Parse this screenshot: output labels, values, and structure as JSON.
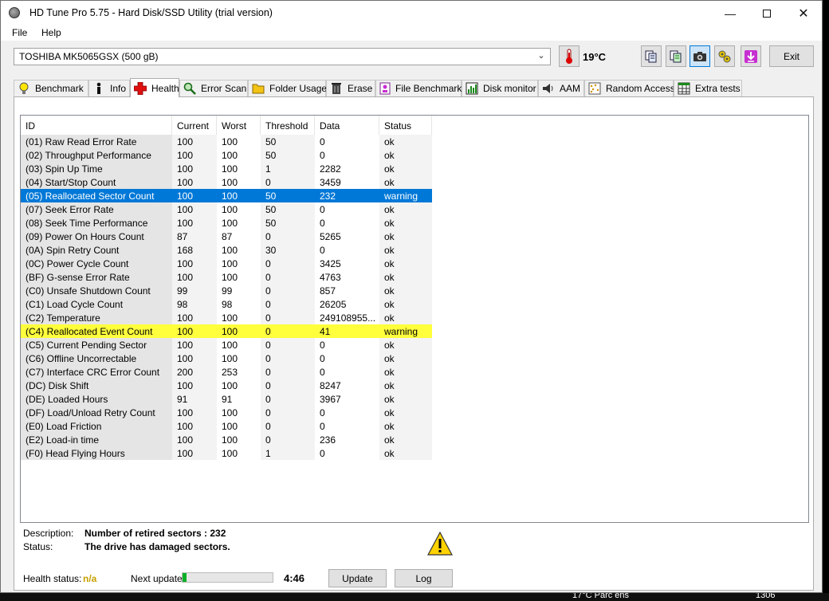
{
  "window": {
    "title": "HD Tune Pro 5.75 - Hard Disk/SSD Utility (trial version)"
  },
  "menu": {
    "file": "File",
    "help": "Help"
  },
  "toolbar": {
    "drive": "TOSHIBA MK5065GSX (500 gB)",
    "temperature": "19°C",
    "exit_label": "Exit"
  },
  "tabs": [
    {
      "label": "Benchmark",
      "icon": "bulb-icon"
    },
    {
      "label": "Info",
      "icon": "info-icon"
    },
    {
      "label": "Health",
      "icon": "cross-icon"
    },
    {
      "label": "Error Scan",
      "icon": "magnifier-icon"
    },
    {
      "label": "Folder Usage",
      "icon": "folder-icon"
    },
    {
      "label": "Erase",
      "icon": "trash-icon"
    },
    {
      "label": "File Benchmark",
      "icon": "file-icon"
    },
    {
      "label": "Disk monitor",
      "icon": "monitor-icon"
    },
    {
      "label": "AAM",
      "icon": "speaker-icon"
    },
    {
      "label": "Random Access",
      "icon": "dots-icon"
    },
    {
      "label": "Extra tests",
      "icon": "grid-icon"
    }
  ],
  "table": {
    "headers": {
      "id": "ID",
      "current": "Current",
      "worst": "Worst",
      "threshold": "Threshold",
      "data": "Data",
      "status": "Status"
    },
    "rows": [
      {
        "id": "(01) Raw Read Error Rate",
        "current": "100",
        "worst": "100",
        "threshold": "50",
        "data": "0",
        "status": "ok"
      },
      {
        "id": "(02) Throughput Performance",
        "current": "100",
        "worst": "100",
        "threshold": "50",
        "data": "0",
        "status": "ok"
      },
      {
        "id": "(03) Spin Up Time",
        "current": "100",
        "worst": "100",
        "threshold": "1",
        "data": "2282",
        "status": "ok"
      },
      {
        "id": "(04) Start/Stop Count",
        "current": "100",
        "worst": "100",
        "threshold": "0",
        "data": "3459",
        "status": "ok"
      },
      {
        "id": "(05) Reallocated Sector Count",
        "current": "100",
        "worst": "100",
        "threshold": "50",
        "data": "232",
        "status": "warning"
      },
      {
        "id": "(07) Seek Error Rate",
        "current": "100",
        "worst": "100",
        "threshold": "50",
        "data": "0",
        "status": "ok"
      },
      {
        "id": "(08) Seek Time Performance",
        "current": "100",
        "worst": "100",
        "threshold": "50",
        "data": "0",
        "status": "ok"
      },
      {
        "id": "(09) Power On Hours Count",
        "current": "87",
        "worst": "87",
        "threshold": "0",
        "data": "5265",
        "status": "ok"
      },
      {
        "id": "(0A) Spin Retry Count",
        "current": "168",
        "worst": "100",
        "threshold": "30",
        "data": "0",
        "status": "ok"
      },
      {
        "id": "(0C) Power Cycle Count",
        "current": "100",
        "worst": "100",
        "threshold": "0",
        "data": "3425",
        "status": "ok"
      },
      {
        "id": "(BF) G-sense Error Rate",
        "current": "100",
        "worst": "100",
        "threshold": "0",
        "data": "4763",
        "status": "ok"
      },
      {
        "id": "(C0) Unsafe Shutdown Count",
        "current": "99",
        "worst": "99",
        "threshold": "0",
        "data": "857",
        "status": "ok"
      },
      {
        "id": "(C1) Load Cycle Count",
        "current": "98",
        "worst": "98",
        "threshold": "0",
        "data": "26205",
        "status": "ok"
      },
      {
        "id": "(C2) Temperature",
        "current": "100",
        "worst": "100",
        "threshold": "0",
        "data": "249108955...",
        "status": "ok"
      },
      {
        "id": "(C4) Reallocated Event Count",
        "current": "100",
        "worst": "100",
        "threshold": "0",
        "data": "41",
        "status": "warning"
      },
      {
        "id": "(C5) Current Pending Sector",
        "current": "100",
        "worst": "100",
        "threshold": "0",
        "data": "0",
        "status": "ok"
      },
      {
        "id": "(C6) Offline Uncorrectable",
        "current": "100",
        "worst": "100",
        "threshold": "0",
        "data": "0",
        "status": "ok"
      },
      {
        "id": "(C7) Interface CRC Error Count",
        "current": "200",
        "worst": "253",
        "threshold": "0",
        "data": "0",
        "status": "ok"
      },
      {
        "id": "(DC) Disk Shift",
        "current": "100",
        "worst": "100",
        "threshold": "0",
        "data": "8247",
        "status": "ok"
      },
      {
        "id": "(DE) Loaded Hours",
        "current": "91",
        "worst": "91",
        "threshold": "0",
        "data": "3967",
        "status": "ok"
      },
      {
        "id": "(DF) Load/Unload Retry Count",
        "current": "100",
        "worst": "100",
        "threshold": "0",
        "data": "0",
        "status": "ok"
      },
      {
        "id": "(E0) Load Friction",
        "current": "100",
        "worst": "100",
        "threshold": "0",
        "data": "0",
        "status": "ok"
      },
      {
        "id": "(E2) Load-in time",
        "current": "100",
        "worst": "100",
        "threshold": "0",
        "data": "236",
        "status": "ok"
      },
      {
        "id": "(F0) Head Flying Hours",
        "current": "100",
        "worst": "100",
        "threshold": "1",
        "data": "0",
        "status": "ok"
      }
    ]
  },
  "details": {
    "description_label": "Description:",
    "description_value": "Number of retired sectors : 232",
    "status_label": "Status:",
    "status_value": "The drive has damaged sectors."
  },
  "footer": {
    "health_label": "Health status:",
    "health_value": "n/a",
    "next_update_label": "Next update:",
    "progress": 0.04,
    "countdown": "4:46",
    "update_label": "Update",
    "log_label": "Log"
  },
  "taskbar": {
    "weather": "17°C  Parc ens",
    "clock": "1306"
  },
  "colors": {
    "selection": "#0078d7",
    "warning_row": "#ffff3c",
    "progress": "#06b025"
  }
}
